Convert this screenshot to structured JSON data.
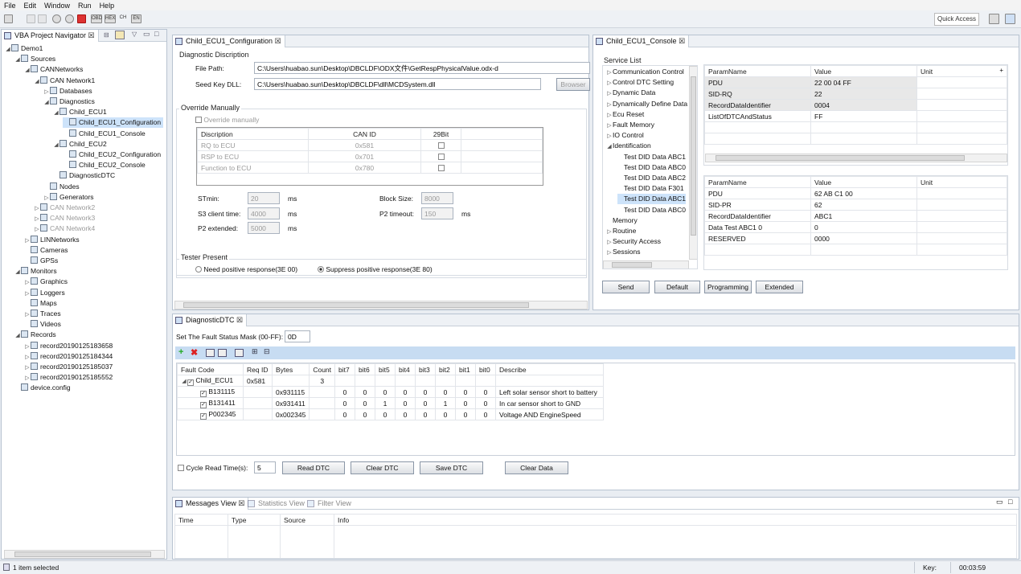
{
  "menu": [
    "File",
    "Edit",
    "Window",
    "Run",
    "Help"
  ],
  "toolbar": {
    "quick_access": "Quick Access",
    "obd": "OBD",
    "hex": "HEX",
    "ch": "CH",
    "en": "EN"
  },
  "navigator": {
    "title": "VBA Project Navigator",
    "tree": [
      {
        "label": "Demo1",
        "tw": "◢",
        "lvl": 0
      },
      {
        "label": "Sources",
        "tw": "◢",
        "lvl": 1
      },
      {
        "label": "CANNetworks",
        "tw": "◢",
        "lvl": 2
      },
      {
        "label": "CAN Network1",
        "tw": "◢",
        "lvl": 3
      },
      {
        "label": "Databases",
        "tw": "▷",
        "lvl": 4
      },
      {
        "label": "Diagnostics",
        "tw": "◢",
        "lvl": 4
      },
      {
        "label": "Child_ECU1",
        "tw": "◢",
        "lvl": 5
      },
      {
        "label": "Child_ECU1_Configuration",
        "tw": "",
        "lvl": 6,
        "sel": true
      },
      {
        "label": "Child_ECU1_Console",
        "tw": "",
        "lvl": 6
      },
      {
        "label": "Child_ECU2",
        "tw": "◢",
        "lvl": 5
      },
      {
        "label": "Child_ECU2_Configuration",
        "tw": "",
        "lvl": 6
      },
      {
        "label": "Child_ECU2_Console",
        "tw": "",
        "lvl": 6
      },
      {
        "label": "DiagnosticDTC",
        "tw": "",
        "lvl": 5
      },
      {
        "label": "Nodes",
        "tw": "",
        "lvl": 4
      },
      {
        "label": "Generators",
        "tw": "▷",
        "lvl": 4
      },
      {
        "label": "CAN Network2",
        "tw": "▷",
        "lvl": 3,
        "gray": true
      },
      {
        "label": "CAN Network3",
        "tw": "▷",
        "lvl": 3,
        "gray": true
      },
      {
        "label": "CAN Network4",
        "tw": "▷",
        "lvl": 3,
        "gray": true
      },
      {
        "label": "LINNetworks",
        "tw": "▷",
        "lvl": 2
      },
      {
        "label": "Cameras",
        "tw": "",
        "lvl": 2
      },
      {
        "label": "GPSs",
        "tw": "",
        "lvl": 2
      },
      {
        "label": "Monitors",
        "tw": "◢",
        "lvl": 1
      },
      {
        "label": "Graphics",
        "tw": "▷",
        "lvl": 2
      },
      {
        "label": "Loggers",
        "tw": "▷",
        "lvl": 2
      },
      {
        "label": "Maps",
        "tw": "",
        "lvl": 2
      },
      {
        "label": "Traces",
        "tw": "▷",
        "lvl": 2
      },
      {
        "label": "Videos",
        "tw": "",
        "lvl": 2
      },
      {
        "label": "Records",
        "tw": "◢",
        "lvl": 1
      },
      {
        "label": "record20190125183658",
        "tw": "▷",
        "lvl": 2
      },
      {
        "label": "record20190125184344",
        "tw": "▷",
        "lvl": 2
      },
      {
        "label": "record20190125185037",
        "tw": "▷",
        "lvl": 2
      },
      {
        "label": "record20190125185552",
        "tw": "▷",
        "lvl": 2
      },
      {
        "label": "device.config",
        "tw": "",
        "lvl": 1
      }
    ]
  },
  "config": {
    "tab": "Child_ECU1_Configuration",
    "diag_desc": "Diagnostic Discription",
    "file_path_label": "File Path:",
    "file_path": "C:\\Users\\huabao.sun\\Desktop\\DBCLDF\\ODX文件\\GetRespPhysicalValue.odx-d",
    "seed_label": "Seed Key DLL:",
    "seed_path": "C:\\Users\\huabao.sun\\Desktop\\DBCLDF\\dll\\MCDSystem.dll",
    "browser": "Browser",
    "override_group": "Override Manually",
    "override_cb": "Override manually",
    "table_headers": [
      "Discription",
      "CAN ID",
      "29Bit"
    ],
    "table_rows": [
      [
        "RQ to ECU",
        "0x581"
      ],
      [
        "RSP to ECU",
        "0x701"
      ],
      [
        "Function to ECU",
        "0x780"
      ]
    ],
    "stmin_label": "STmin:",
    "stmin": "20",
    "ms": "ms",
    "s3_label": "S3 client time:",
    "s3": "4000",
    "p2ext_label": "P2 extended:",
    "p2ext": "5000",
    "block_label": "Block Size:",
    "block": "8000",
    "p2to_label": "P2 timeout:",
    "p2to": "150",
    "tester_group": "Tester Present",
    "radio1": "Need positive response(3E 00)",
    "radio2": "Suppress positive response(3E 80)"
  },
  "console": {
    "tab": "Child_ECU1_Console",
    "service_list": "Service List",
    "services": [
      {
        "label": "Communication Control",
        "tw": "▷",
        "lvl": 0
      },
      {
        "label": "Control DTC Setting",
        "tw": "▷",
        "lvl": 0
      },
      {
        "label": "Dynamic Data",
        "tw": "▷",
        "lvl": 0
      },
      {
        "label": "Dynamically Define Data",
        "tw": "▷",
        "lvl": 0
      },
      {
        "label": "Ecu Reset",
        "tw": "▷",
        "lvl": 0
      },
      {
        "label": "Fault Memory",
        "tw": "▷",
        "lvl": 0
      },
      {
        "label": "IO Control",
        "tw": "▷",
        "lvl": 0
      },
      {
        "label": "Identification",
        "tw": "◢",
        "lvl": 0
      },
      {
        "label": "Test DID Data ABC1",
        "tw": "",
        "lvl": 1
      },
      {
        "label": "Test DID Data ABC0",
        "tw": "",
        "lvl": 1
      },
      {
        "label": "Test DID Data ABC2",
        "tw": "",
        "lvl": 1
      },
      {
        "label": "Test DID Data F301",
        "tw": "",
        "lvl": 1
      },
      {
        "label": "Test DID Data ABC1",
        "tw": "",
        "lvl": 1,
        "sel": true
      },
      {
        "label": "Test DID Data ABC0",
        "tw": "",
        "lvl": 1
      },
      {
        "label": "Memory",
        "tw": "",
        "lvl": 0
      },
      {
        "label": "Routine",
        "tw": "▷",
        "lvl": 0
      },
      {
        "label": "Security Access",
        "tw": "▷",
        "lvl": 0
      },
      {
        "label": "Sessions",
        "tw": "▷",
        "lvl": 0
      }
    ],
    "req_headers": [
      "ParamName",
      "Value",
      "Unit"
    ],
    "req_rows": [
      [
        "PDU",
        "22 00 04 FF",
        ""
      ],
      [
        "SID-RQ",
        "22",
        ""
      ],
      [
        "RecordDataIdentifier",
        "0004",
        ""
      ],
      [
        "ListOfDTCAndStatus",
        "FF",
        ""
      ]
    ],
    "resp_headers": [
      "ParamName",
      "Value",
      "Unit"
    ],
    "resp_rows": [
      [
        "PDU",
        "62 AB C1 00",
        ""
      ],
      [
        "SID-PR",
        "62",
        ""
      ],
      [
        "RecordDataIdentifier",
        "ABC1",
        ""
      ],
      [
        "Data Test ABC1 0",
        "0",
        ""
      ],
      [
        "RESERVED",
        "0000",
        ""
      ]
    ],
    "buttons": [
      "Send",
      "Default",
      "Programming",
      "Extended"
    ]
  },
  "dtc": {
    "tab": "DiagnosticDTC",
    "mask_label": "Set The Fault Status Mask (00-FF):",
    "mask": "0D",
    "headers": [
      "Fault Code",
      "Req ID",
      "Bytes",
      "Count",
      "bit7",
      "bit6",
      "bit5",
      "bit4",
      "bit3",
      "bit2",
      "bit1",
      "bit0",
      "Describe"
    ],
    "parent": {
      "code": "Child_ECU1",
      "req": "0x581",
      "count": "3"
    },
    "rows": [
      {
        "code": "B131115",
        "bytes": "0x931115",
        "bits": [
          "0",
          "0",
          "0",
          "0",
          "0",
          "0",
          "0",
          "0"
        ],
        "desc": "Left solar sensor short to battery"
      },
      {
        "code": "B131411",
        "bytes": "0x931411",
        "bits": [
          "0",
          "0",
          "1",
          "0",
          "0",
          "1",
          "0",
          "0"
        ],
        "desc": "In car sensor short to GND"
      },
      {
        "code": "P002345",
        "bytes": "0x002345",
        "bits": [
          "0",
          "0",
          "0",
          "0",
          "0",
          "0",
          "0",
          "0"
        ],
        "desc": "Voltage AND EngineSpeed"
      }
    ],
    "cycle_label": "Cycle Read Time(s):",
    "cycle": "5",
    "buttons": [
      "Read DTC",
      "Clear DTC",
      "Save DTC",
      "Clear Data"
    ]
  },
  "messages": {
    "tabs": [
      "Messages View",
      "Statistics View",
      "Filter View"
    ],
    "headers": [
      "Time",
      "Type",
      "Source",
      "Info"
    ]
  },
  "status": {
    "left": "1 item selected",
    "key_label": "Key:",
    "time": "00:03:59"
  }
}
